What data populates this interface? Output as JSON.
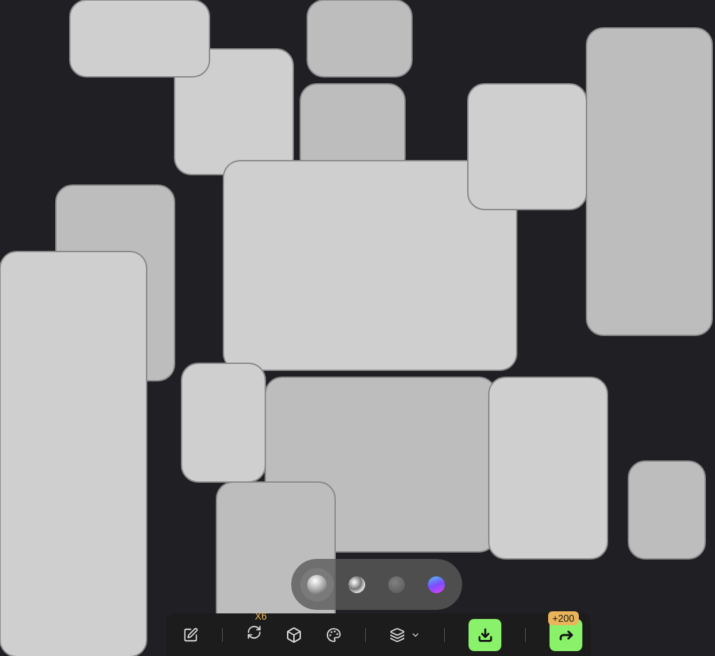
{
  "materials": [
    {
      "kind": "matte",
      "selected": true
    },
    {
      "kind": "metal",
      "selected": false
    },
    {
      "kind": "clay",
      "selected": false
    },
    {
      "kind": "iridescent",
      "selected": false
    }
  ],
  "toolbar": {
    "retry_badge": "X6",
    "share_badge": "+200"
  }
}
